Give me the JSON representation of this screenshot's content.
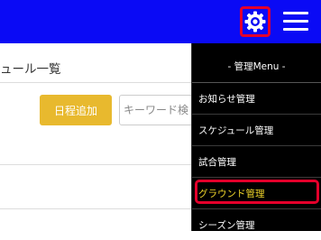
{
  "header": {
    "background": "#0a0af5",
    "settings_icon": "gear-icon",
    "menu_icon": "hamburger-icon",
    "highlight_color": "#e4002b"
  },
  "main": {
    "title": "ュール一覧",
    "add_button_label": "日程追加",
    "search_placeholder": "キーワード検"
  },
  "menu": {
    "header": "- 管理Menu -",
    "items": [
      {
        "label": "お知らせ管理"
      },
      {
        "label": "スケジュール管理"
      },
      {
        "label": "試合管理"
      },
      {
        "label": "グラウンド管理"
      },
      {
        "label": "シーズン管理"
      }
    ],
    "active_item_color": "#f1d52a"
  }
}
